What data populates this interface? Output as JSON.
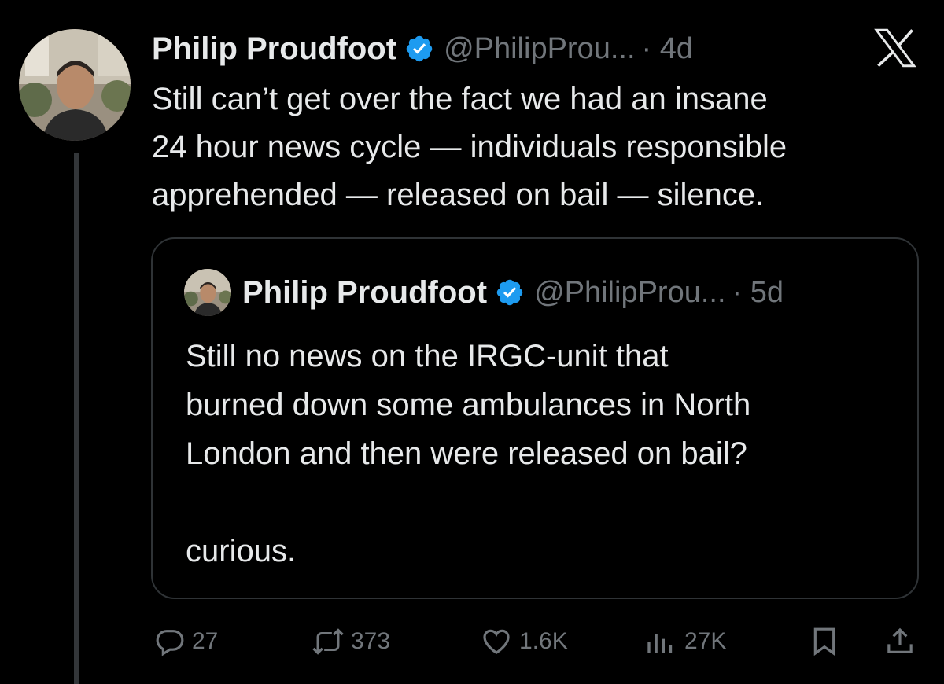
{
  "tweet": {
    "author_name": "Philip Proudfoot",
    "author_handle": "@PhilipProu...",
    "time": "· 4d",
    "text_lines": [
      "Still can’t get over the fact we had an insane",
      "24 hour news cycle — individuals responsible",
      "apprehended — released on bail — silence."
    ]
  },
  "quote": {
    "author_name": "Philip Proudfoot",
    "author_handle": "@PhilipProu...",
    "time": "· 5d",
    "text_lines": [
      "Still no news on the IRGC-unit that",
      "burned down some ambulances in North",
      "London and then were released on bail?",
      "",
      "curious."
    ]
  },
  "actions": {
    "reply_count": "27",
    "repost_count": "373",
    "like_count": "1.6K",
    "views_count": "27K"
  },
  "icons": {
    "verified": "verified-badge-icon",
    "logo": "x-logo-icon",
    "reply": "reply-icon",
    "repost": "repost-icon",
    "like": "heart-icon",
    "views": "views-icon",
    "bookmark": "bookmark-icon",
    "share": "share-icon"
  },
  "colors": {
    "background": "#000000",
    "text": "#e7e9ea",
    "secondary_text": "#71767b",
    "verified_blue": "#1d9bf0",
    "border": "#2f3336"
  }
}
